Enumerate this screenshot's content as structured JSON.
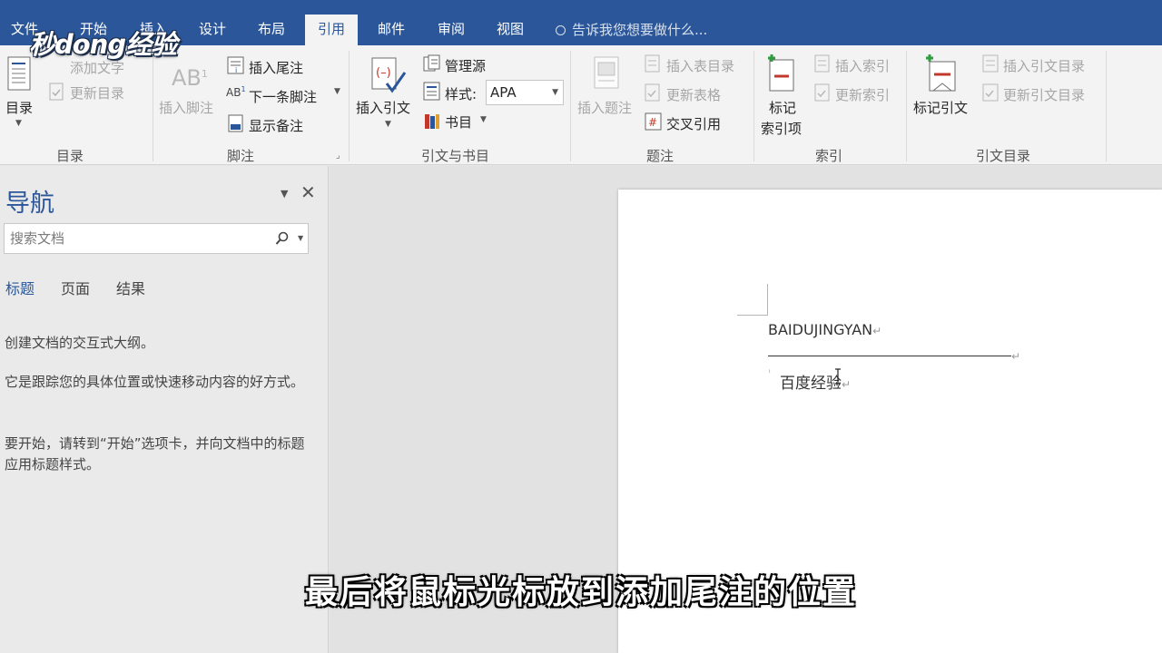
{
  "watermark": {
    "text": "秒dong经验"
  },
  "tabs": [
    {
      "id": "file",
      "label": "文件"
    },
    {
      "id": "home",
      "label": "开始"
    },
    {
      "id": "insert",
      "label": "插入"
    },
    {
      "id": "design",
      "label": "设计"
    },
    {
      "id": "layout",
      "label": "布局"
    },
    {
      "id": "references",
      "label": "引用",
      "active": true
    },
    {
      "id": "mailings",
      "label": "邮件"
    },
    {
      "id": "review",
      "label": "审阅"
    },
    {
      "id": "view",
      "label": "视图"
    }
  ],
  "tell_me": "告诉我您想要做什么...",
  "ribbon": {
    "toc": {
      "main": "目录",
      "add_text": "添加文字",
      "update": "更新目录",
      "group": "目录"
    },
    "footnotes": {
      "insert_footnote": "插入脚注",
      "insert_endnote": "插入尾注",
      "next_footnote": "下一条脚注",
      "show_notes": "显示备注",
      "group": "脚注"
    },
    "citations": {
      "insert_citation": "插入引文",
      "manage_sources": "管理源",
      "style_label": "样式:",
      "style_value": "APA",
      "bibliography": "书目",
      "group": "引文与书目"
    },
    "captions": {
      "insert_caption": "插入题注",
      "insert_tof": "插入表目录",
      "update_table": "更新表格",
      "cross_ref": "交叉引用",
      "group": "题注"
    },
    "index": {
      "mark_entry_1": "标记",
      "mark_entry_2": "索引项",
      "insert_index": "插入索引",
      "update_index": "更新索引",
      "group": "索引"
    },
    "toa": {
      "mark_citation": "标记引文",
      "insert_toa": "插入引文目录",
      "update_toa": "更新引文目录",
      "group": "引文目录"
    }
  },
  "nav": {
    "title": "导航",
    "search_placeholder": "搜索文档",
    "tabs": [
      "标题",
      "页面",
      "结果"
    ],
    "para1": "创建文档的交互式大纲。",
    "para2": "它是跟踪您的具体位置或快速移动内容的好方式。",
    "para3": "要开始，请转到“开始”选项卡，并向文档中的标题应用标题样式。"
  },
  "document": {
    "line1": "BAIDUJINGYAN",
    "line2": "百度经验",
    "para_mark": "↵"
  },
  "subtitle": "最后将鼠标光标放到添加尾注的位置",
  "colors": {
    "accent": "#2b579a",
    "ribbon_bg": "#f3f3f3",
    "red_icon": "#c0392b",
    "green_icon": "#2e9c3f"
  }
}
